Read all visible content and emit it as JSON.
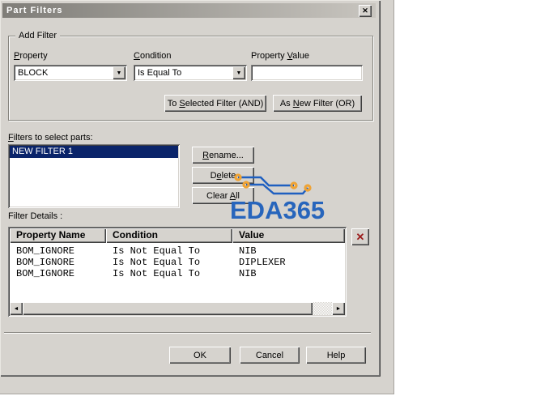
{
  "colors": {
    "titlebar_left": "#7f7d78",
    "titlebar_right": "#c8c5bf",
    "dialog_face": "#d6d3ce",
    "selection_navy": "#0a246a",
    "eda_blue": "#2765bc",
    "trace_blue": "#1f5fc0",
    "pad_orange": "#efa335",
    "delete_x_red": "#9b1c1c"
  },
  "icons": {
    "close_icon": "✕",
    "chevron_down_icon": "▼",
    "scroll_left_icon": "◄",
    "scroll_right_icon": "►",
    "delete_row_icon": "✕"
  },
  "window": {
    "title": "Part Filters"
  },
  "add_filter": {
    "legend": "Add Filter",
    "property_label": {
      "pre": "",
      "mn": "P",
      "post": "roperty"
    },
    "condition_label": {
      "pre": "",
      "mn": "C",
      "post": "ondition"
    },
    "value_label": {
      "pre": "Property ",
      "mn": "V",
      "post": "alue"
    },
    "property_selected": "BLOCK",
    "condition_selected": "Is Equal To",
    "property_value_input": "",
    "and_button": {
      "pre": "To ",
      "mn": "S",
      "post": "elected Filter (AND)"
    },
    "or_button": {
      "pre": "As ",
      "mn": "N",
      "post": "ew Filter (OR)"
    }
  },
  "filters_list": {
    "label": {
      "pre": "",
      "mn": "F",
      "post": "ilters to select parts:"
    },
    "items": [
      "NEW FILTER 1"
    ],
    "selected_index": 0,
    "rename_button": {
      "pre": "",
      "mn": "R",
      "post": "ename..."
    },
    "delete_button": {
      "pre": "D",
      "mn": "e",
      "post": "lete"
    },
    "clear_all_button": {
      "pre": "Clear ",
      "mn": "A",
      "post": "ll"
    }
  },
  "watermark": {
    "text": "EDA365"
  },
  "filter_details": {
    "label": "Filter Details :",
    "headers": [
      "Property Name",
      "Condition",
      "Value"
    ],
    "rows": [
      [
        "BOM_IGNORE",
        "Is Not Equal To",
        "NIB"
      ],
      [
        "BOM_IGNORE",
        "Is Not Equal To",
        "DIPLEXER"
      ],
      [
        "BOM_IGNORE",
        "Is Not Equal To",
        "NIB"
      ]
    ]
  },
  "footer": {
    "ok": "OK",
    "cancel": "Cancel",
    "help": "Help"
  }
}
